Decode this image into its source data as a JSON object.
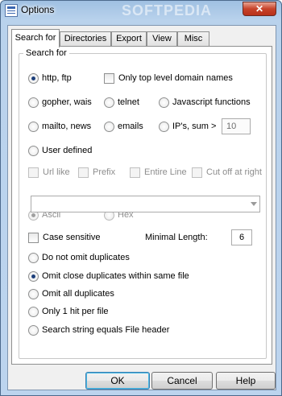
{
  "window": {
    "title": "Options",
    "watermark": "SOFTPEDIA",
    "close_glyph": "✕"
  },
  "tabs": [
    {
      "label": "Search for",
      "active": true
    },
    {
      "label": "Directories",
      "active": false
    },
    {
      "label": "Export",
      "active": false
    },
    {
      "label": "View",
      "active": false
    },
    {
      "label": "Misc",
      "active": false
    }
  ],
  "search_group": {
    "label": "Search for",
    "protocols": {
      "http_ftp": "http, ftp",
      "top_level_domains": "Only top level domain names",
      "gopher_wais": "gopher, wais",
      "telnet": "telnet",
      "javascript": "Javascript functions",
      "mailto_news": "mailto, news",
      "emails": "emails",
      "ips": "IP's,  sum  >",
      "ips_sum_value": "10",
      "user_defined": "User defined"
    },
    "url_options": {
      "url_like": "Url like",
      "prefix": "Prefix",
      "entire_line": "Entire Line",
      "cut_off_right": "Cut off at right"
    },
    "pattern_value": "",
    "encoding": {
      "ascii": "Ascii",
      "hex": "Hex"
    },
    "case_sensitive": "Case sensitive",
    "minimal_length_label": "Minimal Length:",
    "minimal_length_value": "6",
    "duplicates": {
      "do_not_omit": "Do not omit duplicates",
      "omit_close": "Omit close duplicates within same file",
      "omit_all": "Omit all duplicates",
      "one_hit": "Only 1 hit per file",
      "file_header": "Search string equals File header"
    }
  },
  "buttons": {
    "ok": "OK",
    "cancel": "Cancel",
    "help": "Help"
  },
  "colors": {
    "title_bar": "#b9d2ec",
    "close_button": "#c7432a",
    "radio_dot": "#1d3f7a"
  }
}
